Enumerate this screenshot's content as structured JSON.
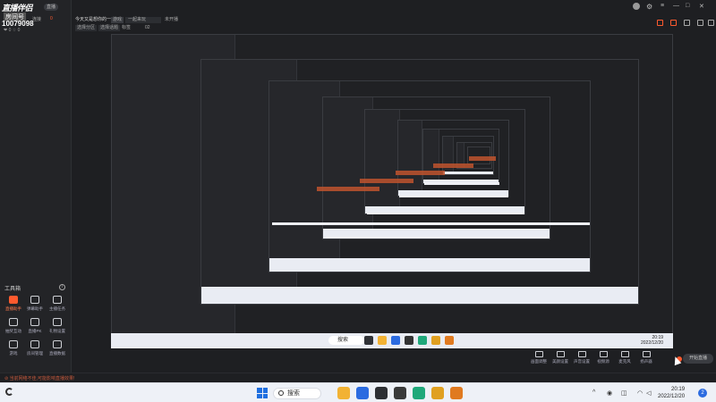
{
  "app": {
    "logo": "直播伴侣",
    "logo_badge": "直播",
    "room_label": "房间号",
    "room_number": "10079098",
    "stats": "❤ 0  ☆ 0",
    "top_tags": [
      "连接",
      "0"
    ]
  },
  "topbar": {
    "title": "今天又是想你的一天",
    "chips": [
      "游戏",
      "一起来玩",
      "未开播"
    ],
    "subchips": [
      "选择分区",
      "选择话题",
      "标签",
      "02"
    ],
    "window_buttons": [
      "—",
      "□",
      "✕"
    ]
  },
  "tools": {
    "title": "工具箱",
    "items": [
      {
        "label": "直播助手",
        "hot": true
      },
      {
        "label": "弹幕助手",
        "hot": false
      },
      {
        "label": "主播任务",
        "hot": false
      },
      {
        "label": "抽奖互动",
        "hot": false
      },
      {
        "label": "直播PK",
        "hot": false
      },
      {
        "label": "礼物设置",
        "hot": false
      },
      {
        "label": "游戏",
        "hot": false
      },
      {
        "label": "房间管理",
        "hot": false
      },
      {
        "label": "直播数据",
        "hot": false
      }
    ]
  },
  "controls": {
    "items": [
      "画面调整",
      "美颜设置",
      "声音设置",
      "视频源",
      "麦克风",
      "扬声器"
    ],
    "live_button": "开始直播"
  },
  "status": {
    "message": "⊘ 当前网络不佳,可能影响直播效果!"
  },
  "inner_taskbar": {
    "search": "搜索",
    "time": "20:19",
    "date": "2022/12/20"
  },
  "taskbar": {
    "search": "搜索",
    "time": "20:19",
    "date": "2022/12/20",
    "notify": "2",
    "tray": [
      "^",
      "◉",
      "◫",
      "⊙"
    ]
  },
  "colors": {
    "accent": "#ff5a2e",
    "background": "#1e1f22",
    "taskbar": "#eef1f7"
  }
}
